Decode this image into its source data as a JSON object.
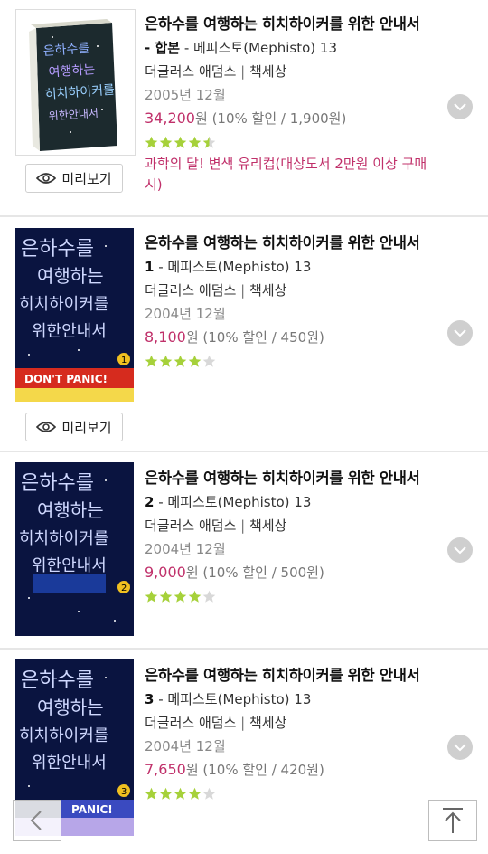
{
  "colors": {
    "accent": "#c0306a",
    "star": "#a6d13a",
    "star_empty": "#d8d8d8"
  },
  "preview_label": "미리보기",
  "books": [
    {
      "title": "은하수를 여행하는 히치하이커를 위한 안내서",
      "volume": "- 합본",
      "series": " - 메피스토(Mephisto) 13",
      "author": "더글러스 애덤스",
      "divider": " | ",
      "publisher": "책세상",
      "date": "2005년 12월",
      "price": "34,200",
      "price_unit": "원",
      "discount": " (10% 할인 / 1,900원)",
      "rating": 4.5,
      "promo": "과학의 달! 변색 유리컵(대상도서 2만원 이상 구매 시)"
    },
    {
      "title": "은하수를 여행하는 히치하이커를 위한 안내서",
      "volume": "1",
      "series": " - 메피스토(Mephisto) 13",
      "author": "더글러스 애덤스",
      "divider": " | ",
      "publisher": "책세상",
      "date": "2004년 12월",
      "price": "8,100",
      "price_unit": "원",
      "discount": " (10% 할인 / 450원)",
      "rating": 4,
      "cover_banner": "DON'T PANIC!"
    },
    {
      "title": "은하수를 여행하는 히치하이커를 위한 안내서",
      "volume": "2",
      "series": " - 메피스토(Mephisto) 13",
      "author": "더글러스 애덤스",
      "divider": " | ",
      "publisher": "책세상",
      "date": "2004년 12월",
      "price": "9,000",
      "price_unit": "원",
      "discount": " (10% 할인 / 500원)",
      "rating": 4
    },
    {
      "title": "은하수를 여행하는 히치하이커를 위한 안내서",
      "volume": "3",
      "series": " - 메피스토(Mephisto) 13",
      "author": "더글러스 애덤스",
      "divider": " | ",
      "publisher": "책세상",
      "date": "2004년 12월",
      "price": "7,650",
      "price_unit": "원",
      "discount": " (10% 할인 / 420원)",
      "rating": 4,
      "cover_banner": "PANIC!"
    }
  ]
}
